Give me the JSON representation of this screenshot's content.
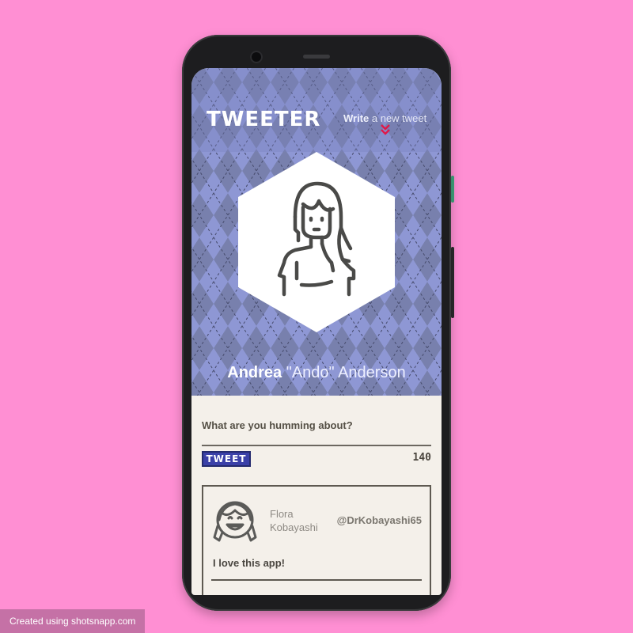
{
  "header": {
    "logo": "TWEETER",
    "write_strong": "Write",
    "write_rest": " a new tweet"
  },
  "profile": {
    "first_name": "Andrea",
    "nickname": " \"Ando\" Anderson"
  },
  "composer": {
    "prompt": "What are you humming about?",
    "button_label": "TWEET",
    "char_count": "140"
  },
  "feed": [
    {
      "author": "Flora Kobayashi",
      "handle": "@DrKobayashi65",
      "text": "I love this app!"
    }
  ],
  "footer": {
    "credit": "Created using shotsnapp.com"
  },
  "colors": {
    "page_bg": "#ff8fd3",
    "pattern_light": "#9aa3e6",
    "pattern_dark": "#7880ad",
    "accent": "#3a40a8",
    "chevron": "#e0194a"
  },
  "icons": {
    "avatar_main": "woman-avatar-icon",
    "avatar_feed": "girl-avatar-icon",
    "chevron": "double-chevron-down-icon"
  }
}
